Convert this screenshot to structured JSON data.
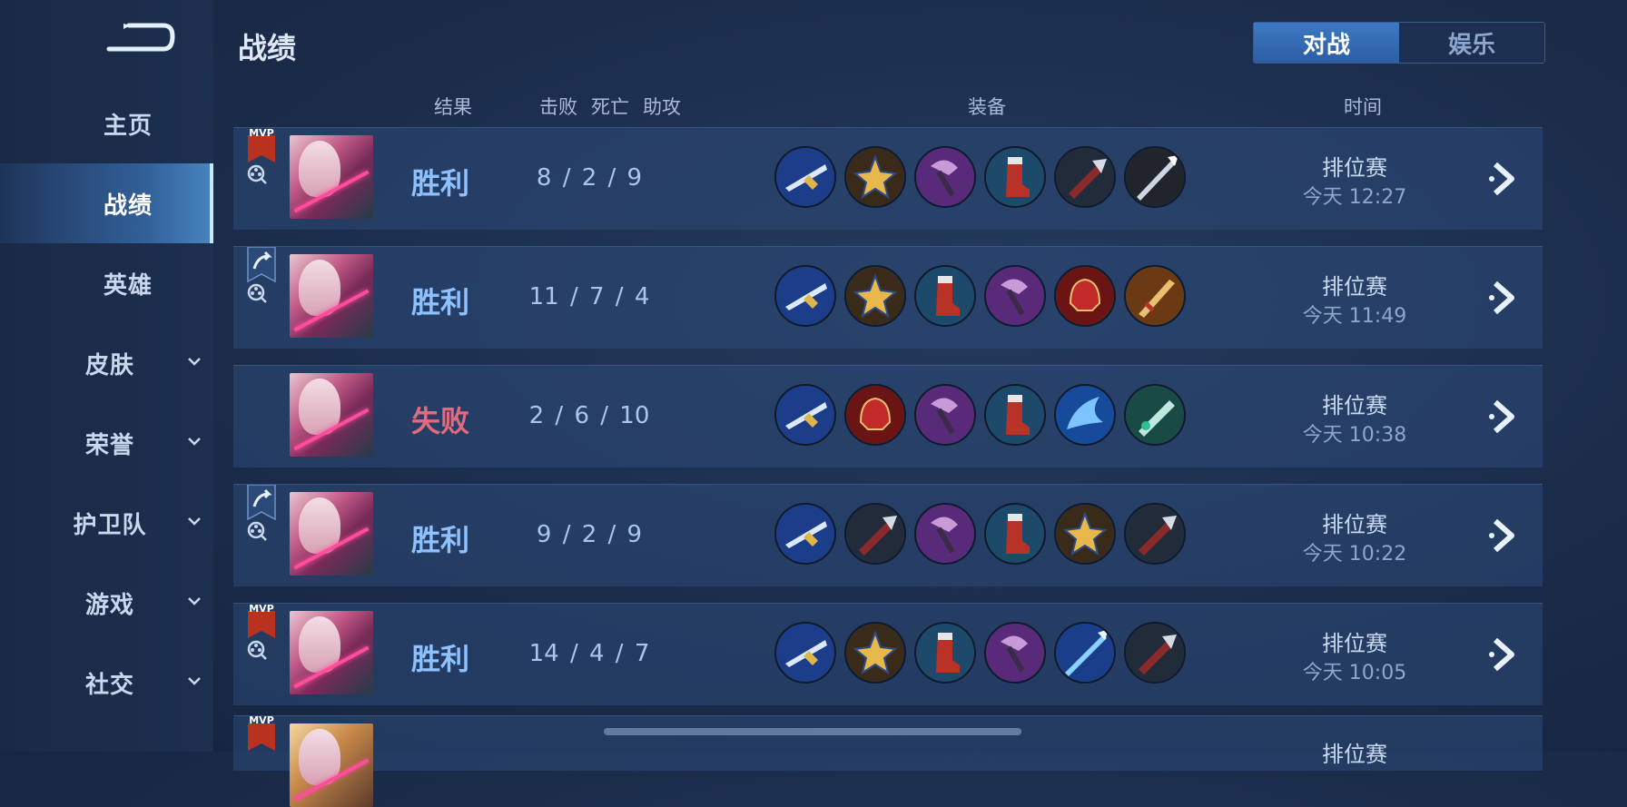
{
  "page": {
    "title": "战绩"
  },
  "tabs": [
    {
      "label": "对战",
      "active": true
    },
    {
      "label": "娱乐",
      "active": false
    }
  ],
  "sidebar": {
    "items": [
      {
        "label": "主页",
        "expandable": false,
        "active": false
      },
      {
        "label": "战绩",
        "expandable": false,
        "active": true
      },
      {
        "label": "英雄",
        "expandable": false,
        "active": false
      },
      {
        "label": "皮肤",
        "expandable": true,
        "active": false
      },
      {
        "label": "荣誉",
        "expandable": true,
        "active": false
      },
      {
        "label": "护卫队",
        "expandable": true,
        "active": false
      },
      {
        "label": "游戏",
        "expandable": true,
        "active": false
      },
      {
        "label": "社交",
        "expandable": true,
        "active": false
      }
    ]
  },
  "columns": {
    "result": "结果",
    "kills": "击败",
    "deaths": "死亡",
    "assists": "助攻",
    "items": "装备",
    "time": "时间"
  },
  "matches": [
    {
      "badge": "MVP",
      "badge_text": "MVP",
      "result": "胜利",
      "win": true,
      "kda": "8 / 2 / 9",
      "mode": "排位赛",
      "time": "今天 12:27",
      "items": [
        "blade-blue",
        "gold-star",
        "purple-axe",
        "red-boots",
        "hand-blade",
        "spear"
      ]
    },
    {
      "badge": "rank-up",
      "badge_text": "",
      "result": "胜利",
      "win": true,
      "kda": "11 / 7 / 4",
      "mode": "排位赛",
      "time": "今天 11:49",
      "items": [
        "blade-blue",
        "gold-star",
        "red-boots",
        "purple-axe",
        "red-helm",
        "gold-sword"
      ]
    },
    {
      "badge": "none",
      "badge_text": "",
      "result": "失败",
      "win": false,
      "kda": "2 / 6 / 10",
      "mode": "排位赛",
      "time": "今天 10:38",
      "items": [
        "blade-blue",
        "red-helm",
        "purple-axe",
        "red-boots",
        "ice-wings",
        "green-sword"
      ]
    },
    {
      "badge": "rank-up",
      "badge_text": "",
      "result": "胜利",
      "win": true,
      "kda": "9 / 2 / 9",
      "mode": "排位赛",
      "time": "今天 10:22",
      "items": [
        "blade-blue",
        "hand-blade",
        "purple-axe",
        "red-boots",
        "gold-star",
        "hand-blade"
      ]
    },
    {
      "badge": "MVP",
      "badge_text": "MVP",
      "result": "胜利",
      "win": true,
      "kda": "14 / 4 / 7",
      "mode": "排位赛",
      "time": "今天 10:05",
      "items": [
        "blade-blue",
        "gold-star",
        "red-boots",
        "purple-axe",
        "ice-spear",
        "hand-blade"
      ]
    }
  ],
  "partial_row": {
    "badge_text": "MVP",
    "mode": "排位赛"
  },
  "colors": {
    "accent": "#3d79c4",
    "win": "#8dc2ff",
    "lose": "#e36a7e"
  }
}
